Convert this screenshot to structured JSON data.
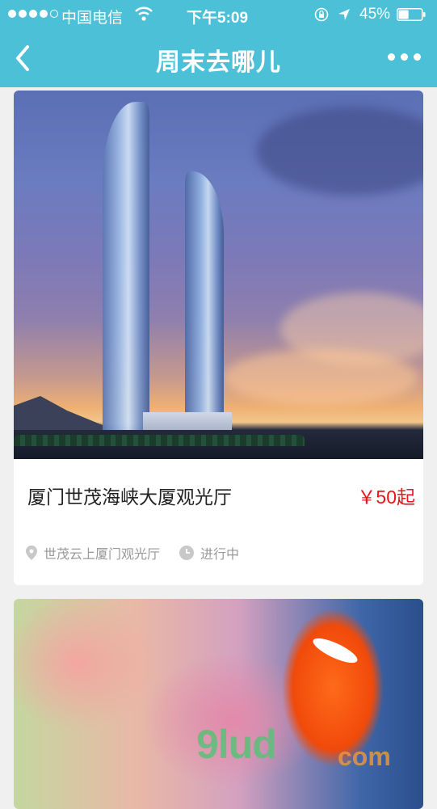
{
  "status_bar": {
    "carrier": "中国电信",
    "time": "下午5:09",
    "battery": "45%",
    "battery_level": 0.45
  },
  "nav": {
    "title": "周末去哪儿"
  },
  "cards": [
    {
      "name": "厦门世茂海峡大厦观光厅",
      "price": "￥50起",
      "location": "世茂云上厦门观光厅",
      "status": "进行中"
    }
  ],
  "watermark": {
    "main": "9lud",
    "suffix": "com"
  },
  "colors": {
    "header": "#4bc0d6",
    "price": "#e8161b",
    "meta_text": "#999999"
  }
}
